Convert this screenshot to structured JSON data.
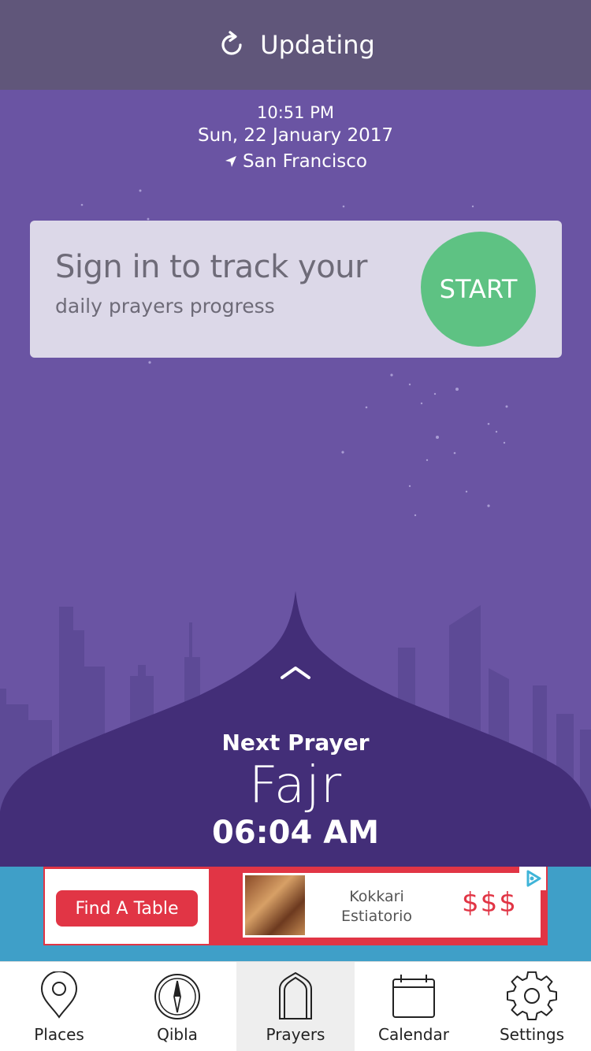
{
  "header": {
    "title": "Updating",
    "icon": "refresh-icon"
  },
  "info": {
    "time": "10:51 PM",
    "date": "Sun, 22 January 2017",
    "location": "San Francisco"
  },
  "signin": {
    "title": "Sign in to track your",
    "subtitle": "daily prayers progress",
    "button": "START"
  },
  "next_prayer": {
    "label": "Next Prayer",
    "name": "Fajr",
    "time": "06:04 AM"
  },
  "ad": {
    "button": "Find A Table",
    "name": "Kokkari Estiatorio",
    "price": "$$$"
  },
  "tabs": [
    {
      "label": "Places",
      "icon": "map-pin-icon"
    },
    {
      "label": "Qibla",
      "icon": "compass-icon"
    },
    {
      "label": "Prayers",
      "icon": "mosque-door-icon",
      "active": true
    },
    {
      "label": "Calendar",
      "icon": "calendar-icon"
    },
    {
      "label": "Settings",
      "icon": "gear-icon"
    }
  ],
  "colors": {
    "header": "#60567a",
    "sky": "#6a54a3",
    "dome": "#432e78",
    "start": "#5ec283",
    "ad": "#e13545",
    "adbar": "#3f9fc8"
  }
}
